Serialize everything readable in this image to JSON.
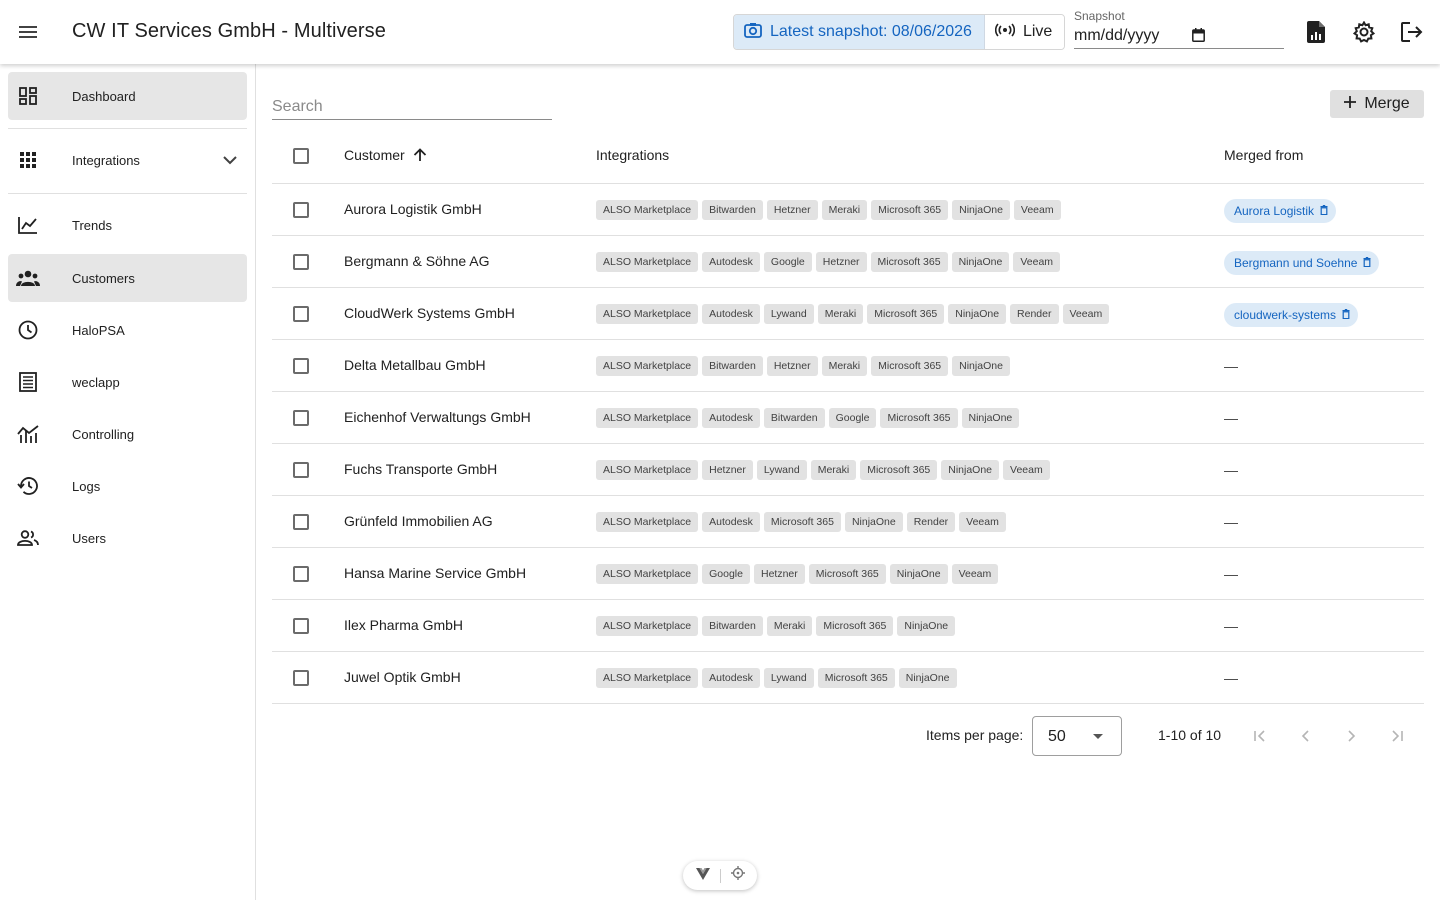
{
  "header": {
    "title": "CW IT Services GmbH - Multiverse",
    "latest_snapshot": "Latest snapshot: 08/06/2026",
    "live_label": "Live",
    "snapshot_label": "Snapshot",
    "snapshot_value": "mm/dd/yyyy"
  },
  "sidebar": {
    "items": [
      {
        "label": "Dashboard"
      },
      {
        "label": "Integrations"
      },
      {
        "label": "Trends"
      },
      {
        "label": "Customers"
      },
      {
        "label": "HaloPSA"
      },
      {
        "label": "weclapp"
      },
      {
        "label": "Controlling"
      },
      {
        "label": "Logs"
      },
      {
        "label": "Users"
      }
    ]
  },
  "main": {
    "search_placeholder": "Search",
    "merge_label": "Merge",
    "columns": {
      "customer": "Customer",
      "integrations": "Integrations",
      "merged_from": "Merged from"
    },
    "rows": [
      {
        "name": "Aurora Logistik GmbH",
        "integrations": [
          "ALSO Marketplace",
          "Bitwarden",
          "Hetzner",
          "Meraki",
          "Microsoft 365",
          "NinjaOne",
          "Veeam"
        ],
        "merged": "Aurora Logistik"
      },
      {
        "name": "Bergmann & Söhne AG",
        "integrations": [
          "ALSO Marketplace",
          "Autodesk",
          "Google",
          "Hetzner",
          "Microsoft 365",
          "NinjaOne",
          "Veeam"
        ],
        "merged": "Bergmann und Soehne"
      },
      {
        "name": "CloudWerk Systems GmbH",
        "integrations": [
          "ALSO Marketplace",
          "Autodesk",
          "Lywand",
          "Meraki",
          "Microsoft 365",
          "NinjaOne",
          "Render",
          "Veeam"
        ],
        "merged": "cloudwerk-systems"
      },
      {
        "name": "Delta Metallbau GmbH",
        "integrations": [
          "ALSO Marketplace",
          "Bitwarden",
          "Hetzner",
          "Meraki",
          "Microsoft 365",
          "NinjaOne"
        ],
        "merged": "—"
      },
      {
        "name": "Eichenhof Verwaltungs GmbH",
        "integrations": [
          "ALSO Marketplace",
          "Autodesk",
          "Bitwarden",
          "Google",
          "Microsoft 365",
          "NinjaOne"
        ],
        "merged": "—"
      },
      {
        "name": "Fuchs Transporte GmbH",
        "integrations": [
          "ALSO Marketplace",
          "Hetzner",
          "Lywand",
          "Meraki",
          "Microsoft 365",
          "NinjaOne",
          "Veeam"
        ],
        "merged": "—"
      },
      {
        "name": "Grünfeld Immobilien AG",
        "integrations": [
          "ALSO Marketplace",
          "Autodesk",
          "Microsoft 365",
          "NinjaOne",
          "Render",
          "Veeam"
        ],
        "merged": "—"
      },
      {
        "name": "Hansa Marine Service GmbH",
        "integrations": [
          "ALSO Marketplace",
          "Google",
          "Hetzner",
          "Microsoft 365",
          "NinjaOne",
          "Veeam"
        ],
        "merged": "—"
      },
      {
        "name": "Ilex Pharma GmbH",
        "integrations": [
          "ALSO Marketplace",
          "Bitwarden",
          "Meraki",
          "Microsoft 365",
          "NinjaOne"
        ],
        "merged": "—"
      },
      {
        "name": "Juwel Optik GmbH",
        "integrations": [
          "ALSO Marketplace",
          "Autodesk",
          "Lywand",
          "Microsoft 365",
          "NinjaOne"
        ],
        "merged": "—"
      }
    ]
  },
  "pagination": {
    "items_per_page_label": "Items per page:",
    "items_per_page": "50",
    "range": "1-10 of 10"
  },
  "colors": {
    "accent": "#1565c0",
    "accent_bg": "#dceaf7",
    "active_nav": "#e6e6e6"
  }
}
